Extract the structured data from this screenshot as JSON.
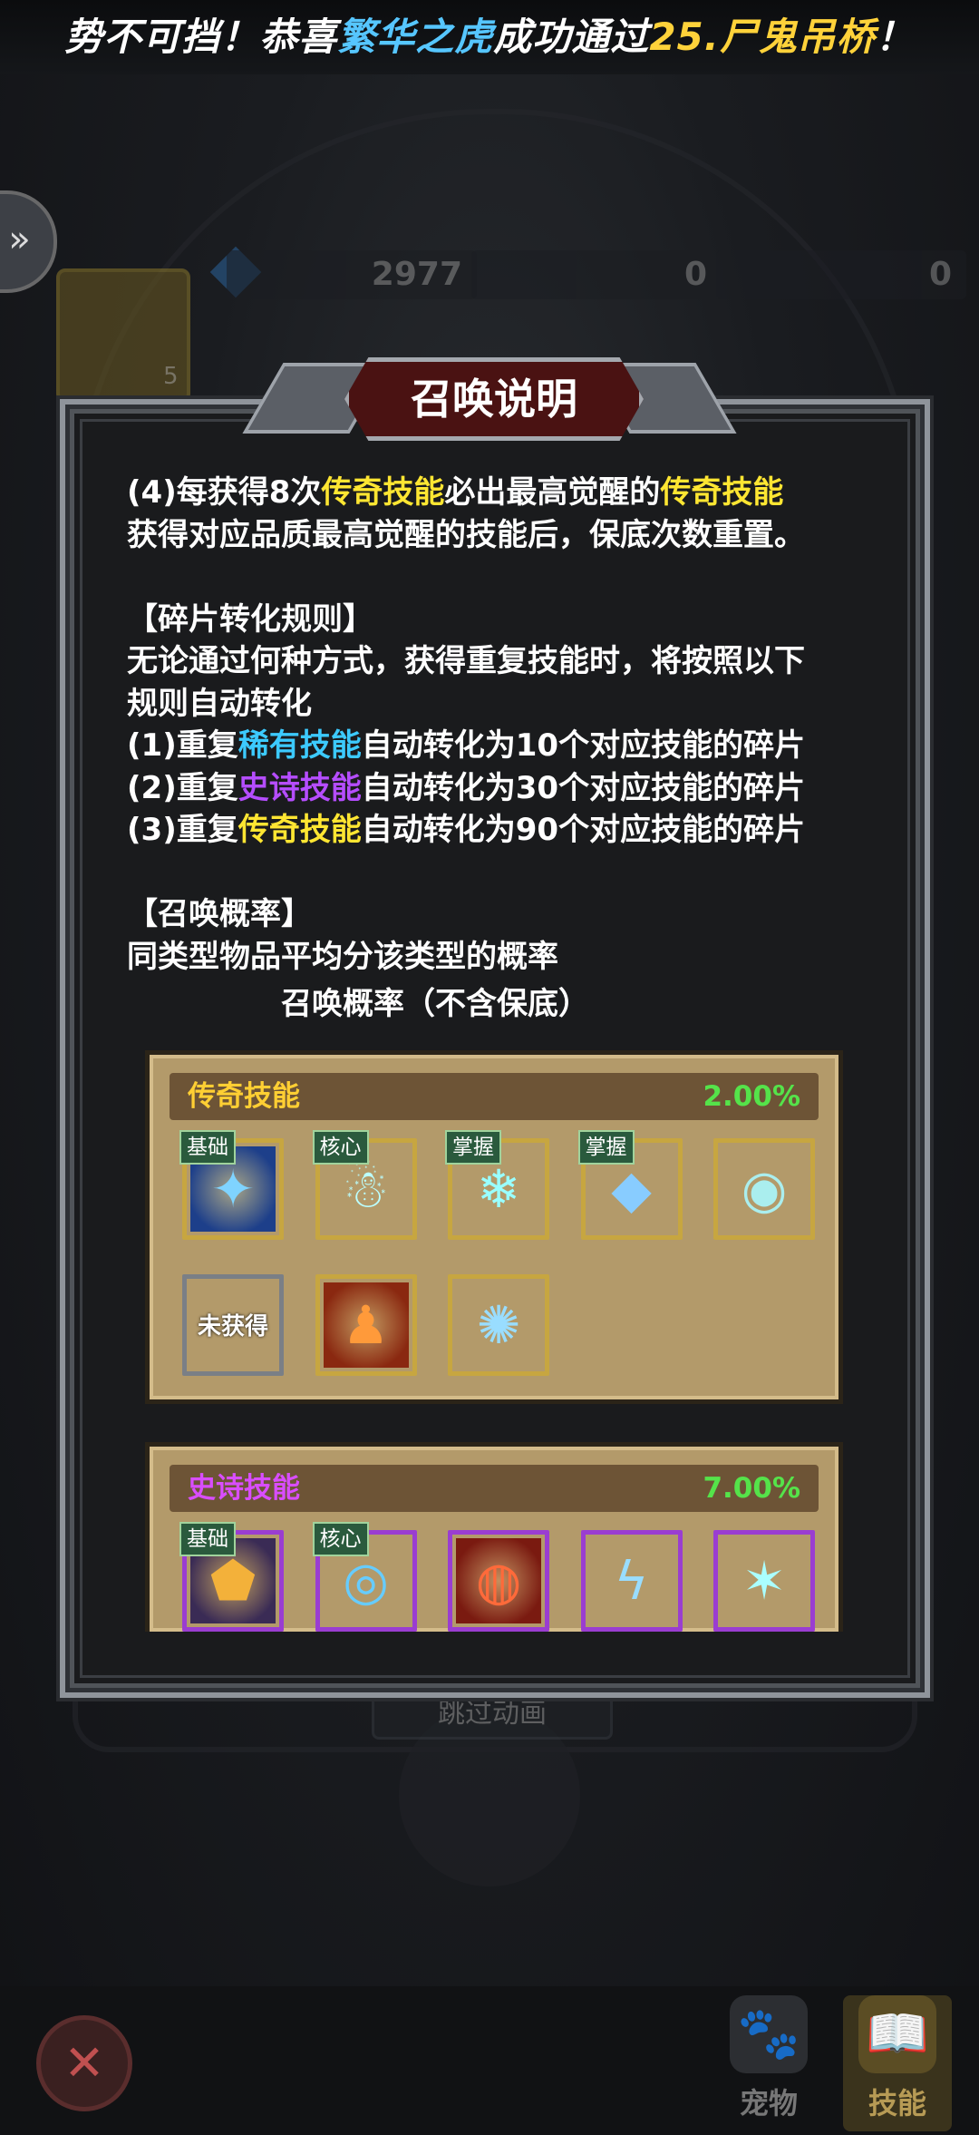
{
  "banner": {
    "part1": "势不可挡！恭喜",
    "player": "繁华之虎",
    "part2": "成功通过",
    "stage": "25.尸鬼吊桥",
    "part3": "！"
  },
  "background": {
    "scroll_count": "5",
    "gems": "2977",
    "scrolls": "0",
    "cross": "0",
    "skip_label": "跳过动画"
  },
  "panel": {
    "title": "召唤说明",
    "rule4_prefix": "(4)每获得8次",
    "rule4_hl1": "传奇技能",
    "rule4_mid": "必出最高觉醒的",
    "rule4_hl2": "传奇技能",
    "rule4_line2": "获得对应品质最高觉醒的技能后，保底次数重置。",
    "frag_header": "【碎片转化规则】",
    "frag_desc1": "无论通过何种方式，获得重复技能时，将按照以下",
    "frag_desc2": "规则自动转化",
    "frag1_prefix": "(1)重复",
    "frag1_hl": "稀有技能",
    "frag1_suffix": "自动转化为10个对应技能的碎片",
    "frag2_prefix": "(2)重复",
    "frag2_hl": "史诗技能",
    "frag2_suffix": "自动转化为30个对应技能的碎片",
    "frag3_prefix": "(3)重复",
    "frag3_hl": "传奇技能",
    "frag3_suffix": "自动转化为90个对应技能的碎片",
    "rate_header": "【召唤概率】",
    "rate_desc": "同类型物品平均分该类型的概率",
    "rate_title": "召唤概率（不含保底）"
  },
  "legend": {
    "name": "传奇技能",
    "pct": "2.00%",
    "icons": [
      {
        "tag": "基础",
        "icon": "ice-shards-icon"
      },
      {
        "tag": "核心",
        "icon": "frost-spirit-icon"
      },
      {
        "tag": "掌握",
        "icon": "snowflake-icon"
      },
      {
        "tag": "掌握",
        "icon": "ice-crystals-icon"
      },
      {
        "tag": "",
        "icon": "eye-triangle-icon"
      },
      {
        "tag": "",
        "icon": "locked-skill-icon",
        "locked_label": "未获得"
      },
      {
        "tag": "",
        "icon": "fire-figure-icon"
      },
      {
        "tag": "",
        "icon": "frost-nova-icon"
      }
    ]
  },
  "epic": {
    "name": "史诗技能",
    "pct": "7.00%",
    "icons": [
      {
        "tag": "基础",
        "icon": "golden-shield-icon"
      },
      {
        "tag": "核心",
        "icon": "water-orb-icon"
      },
      {
        "tag": "",
        "icon": "fire-vortex-icon"
      },
      {
        "tag": "",
        "icon": "lightning-icon"
      },
      {
        "tag": "",
        "icon": "ice-spikes-icon"
      }
    ]
  },
  "nav": {
    "pet_label": "宠物",
    "skill_label": "技能"
  },
  "colors": {
    "legend_accent": "#ffe632",
    "rare_accent": "#3ccaff",
    "epic_accent": "#b54dff",
    "percent_green": "#55e34a",
    "player_name": "#56c6ff",
    "stage_name": "#ffd23a"
  }
}
